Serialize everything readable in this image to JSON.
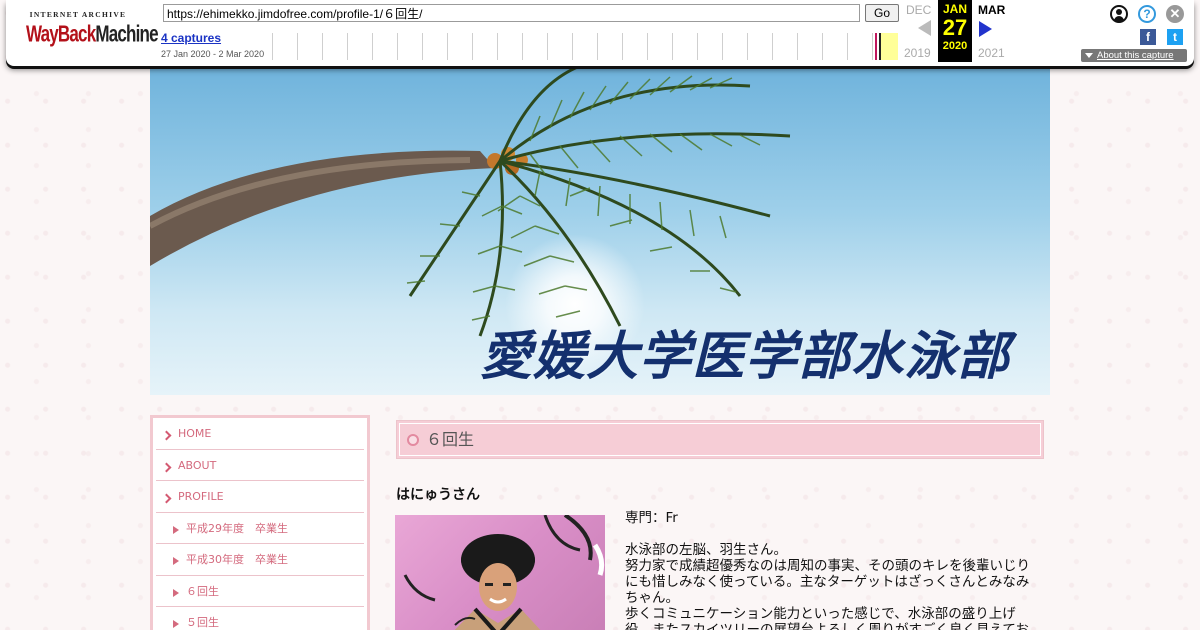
{
  "wayback": {
    "logo_top": "INTERNET ARCHIVE",
    "logo_main_a": "WayBack",
    "logo_main_b": "Machine",
    "url": "https://ehimekko.jimdofree.com/profile-1/６回生/",
    "go_label": "Go",
    "captures_label": "4 captures",
    "date_range": "27 Jan 2020 - 2 Mar 2020",
    "prev_month": "DEC",
    "current_month": "JAN",
    "next_month": "MAR",
    "current_day": "27",
    "prev_year": "2019",
    "current_year": "2020",
    "next_year": "2021",
    "help_glyph": "?",
    "close_glyph": "✕",
    "facebook_glyph": "f",
    "twitter_glyph": "t",
    "about_label": "About this capture",
    "icons": [
      "user-icon",
      "help-icon",
      "close-icon",
      "facebook-icon",
      "twitter-icon"
    ]
  },
  "site": {
    "title": "愛媛大学医学部水泳部"
  },
  "nav": {
    "items": [
      {
        "label": "HOME",
        "level": "top"
      },
      {
        "label": "ABOUT",
        "level": "top"
      },
      {
        "label": "PROFILE",
        "level": "top"
      },
      {
        "label": "平成29年度　卒業生",
        "level": "sub"
      },
      {
        "label": "平成30年度　卒業生",
        "level": "sub"
      },
      {
        "label": "６回生",
        "level": "sub"
      },
      {
        "label": "５回生",
        "level": "sub"
      }
    ]
  },
  "content": {
    "heading": "６回生",
    "member_name": "はにゅうさん",
    "bio": [
      "専門：Fr",
      "",
      "水泳部の左脳、羽生さん。",
      "努力家で成績超優秀なのは周知の事実、その頭のキレを後輩いじり",
      "にも惜しみなく使っている。主なターゲットはざっくさんとみなみ",
      "ちゃん。",
      "歩くコミュニケーション能力といった感じで、水泳部の盛り上げ",
      "役。またスカイツリーの展望台よろしく周りがすごく良く見えてお"
    ]
  },
  "colors": {
    "accent_pink": "#f6cdd6",
    "nav_text": "#d46a7e",
    "title_blue": "#14306e",
    "wayback_red": "#b3111a"
  }
}
